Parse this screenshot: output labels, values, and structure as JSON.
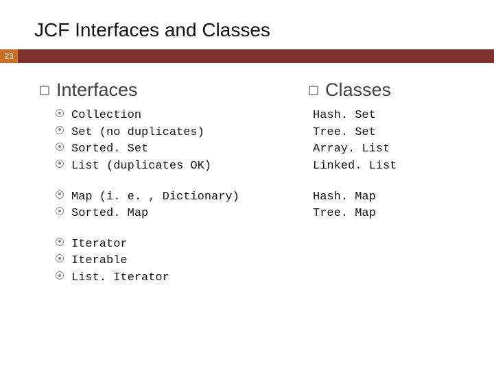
{
  "slide": {
    "number": "23",
    "title": "JCF Interfaces and Classes"
  },
  "left": {
    "heading": "Interfaces",
    "group1": {
      "a": "Collection",
      "b": "Set (no duplicates)",
      "c": "Sorted. Set",
      "d": "List (duplicates OK)"
    },
    "group2": {
      "a": "Map (i. e. , Dictionary)",
      "b": "Sorted. Map"
    },
    "group3": {
      "a": "Iterator",
      "b": "Iterable",
      "c": "List. Iterator"
    }
  },
  "right": {
    "heading": "Classes",
    "group1": {
      "a": "Hash. Set",
      "b": "Tree. Set",
      "c": "Array. List",
      "d": "Linked. List"
    },
    "group2": {
      "a": "Hash. Map",
      "b": "Tree. Map"
    }
  }
}
